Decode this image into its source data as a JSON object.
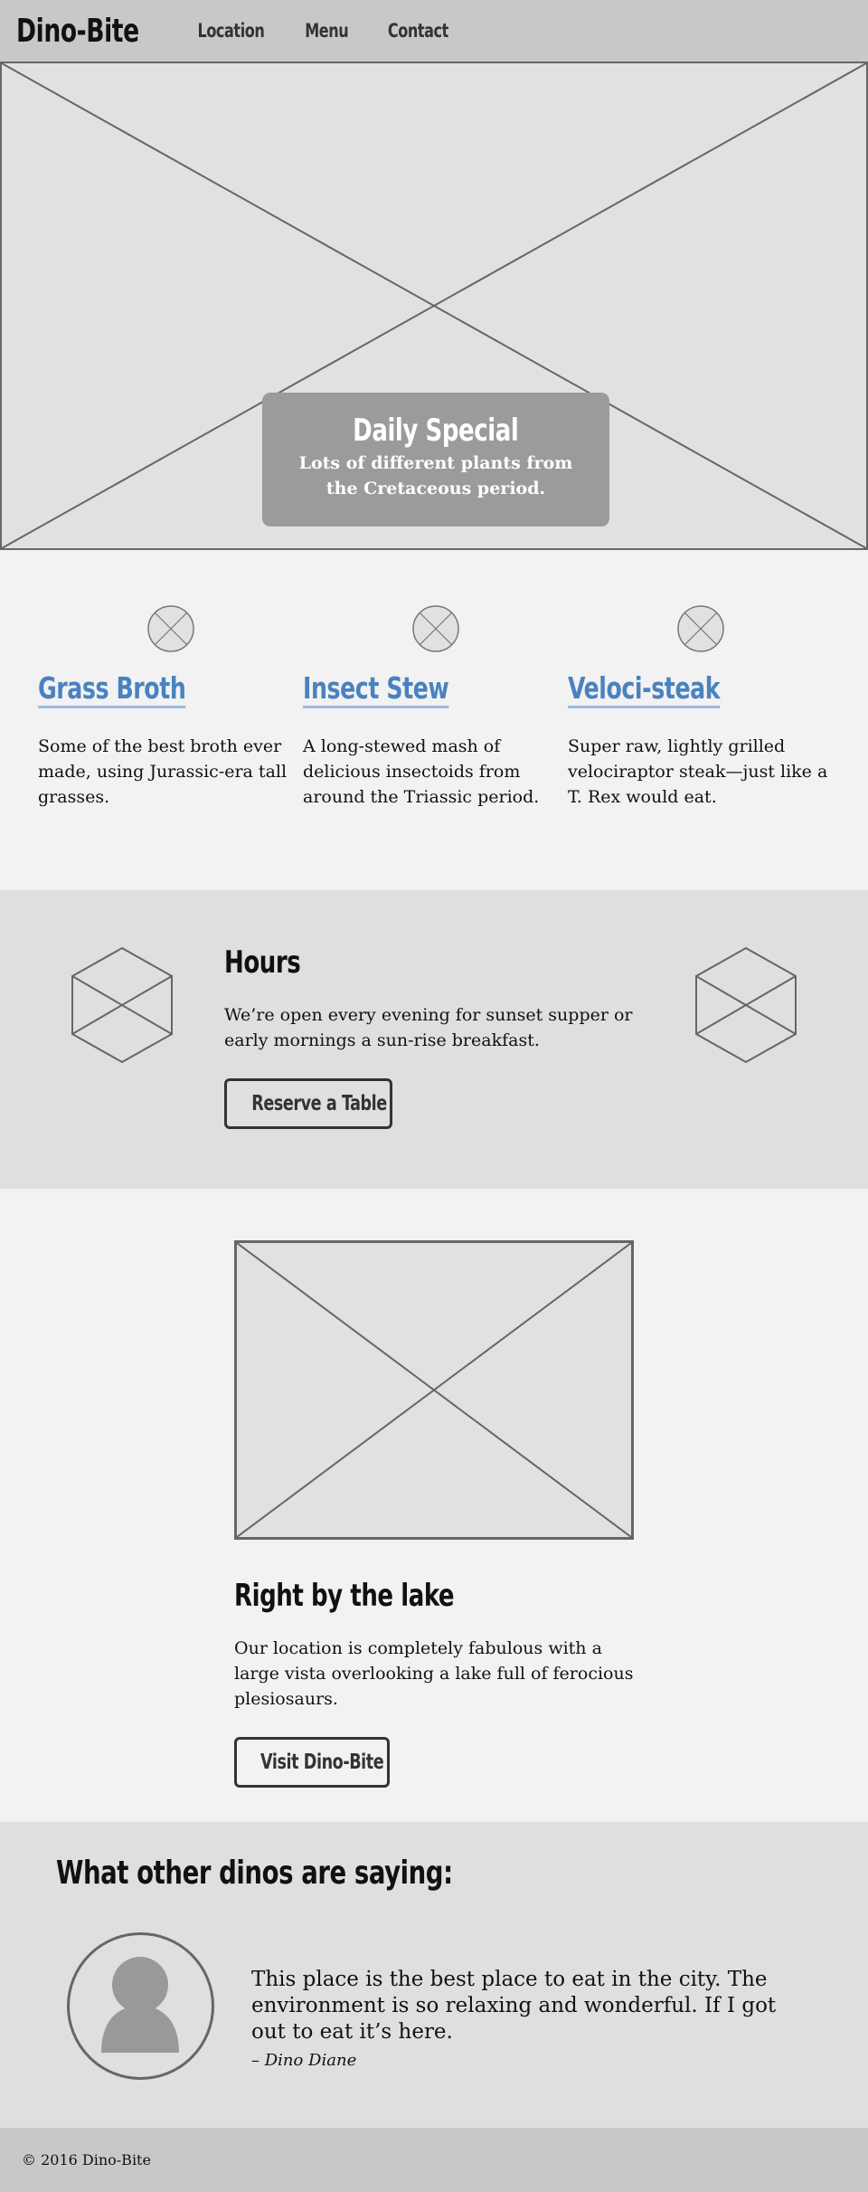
{
  "nav": {
    "brand": "Dino-Bite",
    "links": [
      "Location",
      "Menu",
      "Contact"
    ]
  },
  "hero": {
    "title": "Daily Special",
    "text": "Lots of different plants from the Cretaceous period."
  },
  "features": [
    {
      "title": "Grass Broth",
      "text": "Some of the best broth ever made, using Jurassic-era tall grasses."
    },
    {
      "title": "Insect Stew",
      "text": "A long-stewed mash of delicious insectoids from around the Triassic period."
    },
    {
      "title": "Veloci-steak",
      "text": "Super raw, lightly grilled velociraptor steak—just like a T. Rex would eat."
    }
  ],
  "hours": {
    "title": "Hours",
    "text": "We’re open every evening for sunset supper or early mornings a sun-rise breakfast.",
    "button": "Reserve a Table"
  },
  "location": {
    "title": "Right by the lake",
    "text": "Our location is completely fabulous with a large vista overlooking a lake full of ferocious plesiosaurs.",
    "button": "Visit Dino-Bite"
  },
  "testimonial": {
    "title": "What other dinos are saying:",
    "quote": "This place is the best place to eat in the city. The environment is so relaxing and wonderful. If I got out to eat it’s here.",
    "author": "– Dino Diane"
  },
  "footer": {
    "copyright": "© 2016 Dino-Bite"
  },
  "colors": {
    "accent": "#4a82c0",
    "nav_bg": "#c8c8c8",
    "placeholder_gray": "#e1e1e1"
  }
}
